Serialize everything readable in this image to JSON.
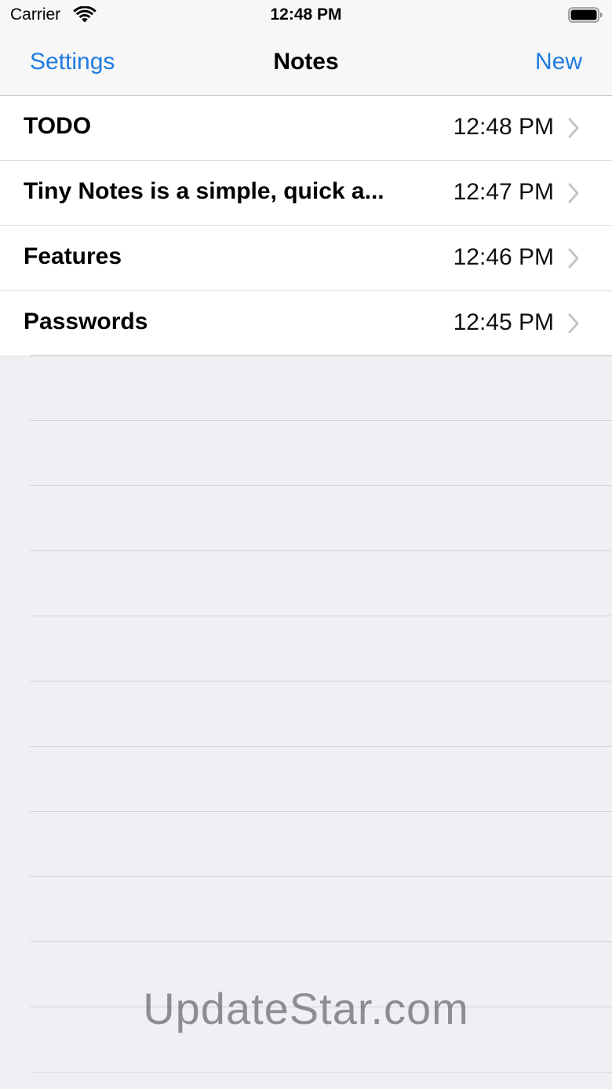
{
  "status_bar": {
    "carrier": "Carrier",
    "time": "12:48 PM",
    "wifi_icon": "wifi-icon",
    "battery_icon": "battery-icon"
  },
  "nav": {
    "left_button": "Settings",
    "title": "Notes",
    "right_button": "New"
  },
  "notes": [
    {
      "title": "TODO",
      "time": "12:48 PM"
    },
    {
      "title": "Tiny Notes is a simple, quick a...",
      "time": "12:47 PM"
    },
    {
      "title": "Features",
      "time": "12:46 PM"
    },
    {
      "title": "Passwords",
      "time": "12:45 PM"
    }
  ],
  "watermark": "UpdateStar.com",
  "colors": {
    "accent": "#1f7ce0",
    "background": "#efeff4",
    "bar_background": "#f7f7f7"
  }
}
